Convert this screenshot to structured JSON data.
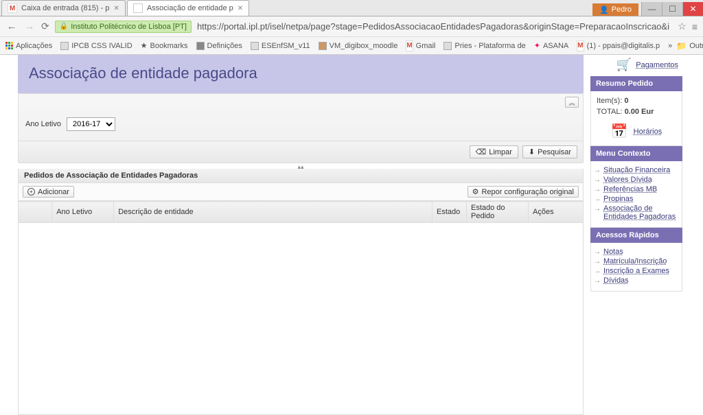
{
  "browser": {
    "tabs": [
      {
        "label": "Caixa de entrada (815) - p"
      },
      {
        "label": "Associação de entidade p"
      }
    ],
    "user_badge": "Pedro",
    "origin_chip": "Instituto Politécnico de Lisboa [PT]",
    "url": "https://portal.ipl.pt/isel/netpa/page?stage=PedidosAssociacaoEntidadesPagadoras&originStage=PreparacaoInscricao&isAluno=true",
    "bookmarks": {
      "apps": "Aplicações",
      "items": [
        "IPCB CSS IVALID",
        "Bookmarks",
        "Definições",
        "ESEnfSM_v11",
        "VM_digibox_moodle",
        "Gmail",
        "Pries - Plataforma de",
        "ASANA",
        "(1) - ppais@digitalis.p"
      ],
      "other": "Outros marcadores"
    }
  },
  "header": {
    "title": "Associação de entidade pagadora"
  },
  "filter": {
    "ano_label": "Ano Letivo",
    "ano_value": "2016-17",
    "limpar_label": "Limpar",
    "pesquisar_label": "Pesquisar"
  },
  "section_title": "Pedidos de Associação de Entidades Pagadoras",
  "toolbar": {
    "add_label": "Adicionar",
    "reset_label": "Repor configuração original"
  },
  "table": {
    "columns": [
      "Ano Letivo",
      "Descrição de entidade",
      "Estado",
      "Estado do Pedido",
      "Ações"
    ]
  },
  "sidebar": {
    "pagamentos": "Pagamentos",
    "resumo_title": "Resumo Pedido",
    "items_label": "Item(s):",
    "items_count": "0",
    "total_label": "TOTAL:",
    "total_value": "0.00 Eur",
    "horarios": "Horários",
    "menu_title": "Menu Contexto",
    "menu_items": [
      "Situação Financeira",
      "Valores Dívida",
      "Referências MB",
      "Propinas",
      "Associação de Entidades Pagadoras"
    ],
    "acessos_title": "Acessos Rápidos",
    "acessos_items": [
      "Notas",
      "Matrícula/Inscrição",
      "Inscrição a Exames",
      "Dívidas"
    ]
  }
}
